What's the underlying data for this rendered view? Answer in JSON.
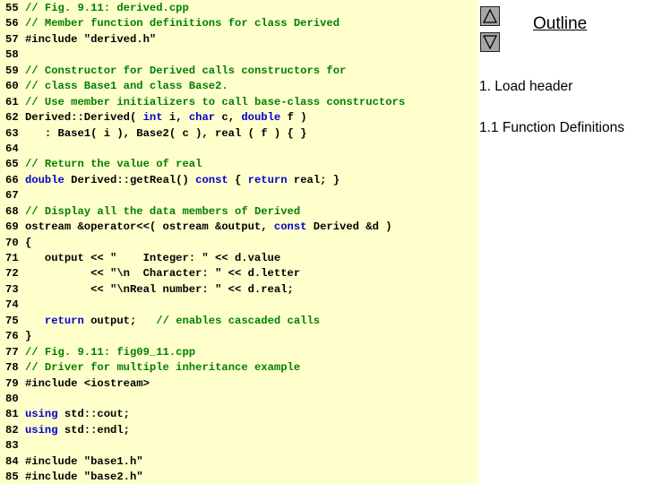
{
  "code": {
    "lines": [
      {
        "n": "55",
        "segments": [
          {
            "t": " ",
            "c": "plain"
          },
          {
            "t": "// Fig. 9.11: derived.cpp",
            "c": "comment"
          }
        ]
      },
      {
        "n": "56",
        "segments": [
          {
            "t": " ",
            "c": "plain"
          },
          {
            "t": "// Member function definitions for class Derived",
            "c": "comment"
          }
        ]
      },
      {
        "n": "57",
        "segments": [
          {
            "t": " #include \"derived.h\"",
            "c": "plain"
          }
        ]
      },
      {
        "n": "58",
        "segments": []
      },
      {
        "n": "59",
        "segments": [
          {
            "t": " ",
            "c": "plain"
          },
          {
            "t": "// Constructor for Derived calls constructors for",
            "c": "comment"
          }
        ]
      },
      {
        "n": "60",
        "segments": [
          {
            "t": " ",
            "c": "plain"
          },
          {
            "t": "// class Base1 and class Base2.",
            "c": "comment"
          }
        ]
      },
      {
        "n": "61",
        "segments": [
          {
            "t": " ",
            "c": "plain"
          },
          {
            "t": "// Use member initializers to call base-class constructors",
            "c": "comment"
          }
        ]
      },
      {
        "n": "62",
        "segments": [
          {
            "t": " Derived::Derived( ",
            "c": "plain"
          },
          {
            "t": "int",
            "c": "kw"
          },
          {
            "t": " i, ",
            "c": "plain"
          },
          {
            "t": "char",
            "c": "kw"
          },
          {
            "t": " c, ",
            "c": "plain"
          },
          {
            "t": "double",
            "c": "kw"
          },
          {
            "t": " f )",
            "c": "plain"
          }
        ]
      },
      {
        "n": "63",
        "segments": [
          {
            "t": "    : Base1( i ), Base2( c ), real ( f ) { }",
            "c": "plain"
          }
        ]
      },
      {
        "n": "64",
        "segments": []
      },
      {
        "n": "65",
        "segments": [
          {
            "t": " ",
            "c": "plain"
          },
          {
            "t": "// Return the value of real",
            "c": "comment"
          }
        ]
      },
      {
        "n": "66",
        "segments": [
          {
            "t": " ",
            "c": "plain"
          },
          {
            "t": "double",
            "c": "kw"
          },
          {
            "t": " Derived::getReal() ",
            "c": "plain"
          },
          {
            "t": "const",
            "c": "kw"
          },
          {
            "t": " { ",
            "c": "plain"
          },
          {
            "t": "return",
            "c": "kw"
          },
          {
            "t": " real; }",
            "c": "plain"
          }
        ]
      },
      {
        "n": "67",
        "segments": []
      },
      {
        "n": "68",
        "segments": [
          {
            "t": " ",
            "c": "plain"
          },
          {
            "t": "// Display all the data members of Derived",
            "c": "comment"
          }
        ]
      },
      {
        "n": "69",
        "segments": [
          {
            "t": " ostream &operator<<( ostream &output, ",
            "c": "plain"
          },
          {
            "t": "const",
            "c": "kw"
          },
          {
            "t": " Derived &d )",
            "c": "plain"
          }
        ]
      },
      {
        "n": "70",
        "segments": [
          {
            "t": " {",
            "c": "plain"
          }
        ]
      },
      {
        "n": "71",
        "segments": [
          {
            "t": "    output << \"    Integer: \" << d.value",
            "c": "plain"
          }
        ]
      },
      {
        "n": "72",
        "segments": [
          {
            "t": "           << \"\\n  Character: \" << d.letter",
            "c": "plain"
          }
        ]
      },
      {
        "n": "73",
        "segments": [
          {
            "t": "           << \"\\nReal number: \" << d.real;",
            "c": "plain"
          }
        ]
      },
      {
        "n": "74",
        "segments": []
      },
      {
        "n": "75",
        "segments": [
          {
            "t": "    ",
            "c": "plain"
          },
          {
            "t": "return",
            "c": "kw"
          },
          {
            "t": " output;   ",
            "c": "plain"
          },
          {
            "t": "// enables cascaded calls",
            "c": "comment"
          }
        ]
      },
      {
        "n": "76",
        "segments": [
          {
            "t": " }",
            "c": "plain"
          }
        ]
      },
      {
        "n": "77",
        "segments": [
          {
            "t": " ",
            "c": "plain"
          },
          {
            "t": "// Fig. 9.11: fig09_11.cpp",
            "c": "comment"
          }
        ]
      },
      {
        "n": "78",
        "segments": [
          {
            "t": " ",
            "c": "plain"
          },
          {
            "t": "// Driver for multiple inheritance example",
            "c": "comment"
          }
        ]
      },
      {
        "n": "79",
        "segments": [
          {
            "t": " #include <iostream>",
            "c": "plain"
          }
        ]
      },
      {
        "n": "80",
        "segments": []
      },
      {
        "n": "81",
        "segments": [
          {
            "t": " ",
            "c": "plain"
          },
          {
            "t": "using",
            "c": "kw"
          },
          {
            "t": " std::cout;",
            "c": "plain"
          }
        ]
      },
      {
        "n": "82",
        "segments": [
          {
            "t": " ",
            "c": "plain"
          },
          {
            "t": "using",
            "c": "kw"
          },
          {
            "t": " std::endl;",
            "c": "plain"
          }
        ]
      },
      {
        "n": "83",
        "segments": []
      },
      {
        "n": "84",
        "segments": [
          {
            "t": " #include \"base1.h\"",
            "c": "plain"
          }
        ]
      },
      {
        "n": "85",
        "segments": [
          {
            "t": " #include \"base2.h\"",
            "c": "plain"
          }
        ]
      }
    ]
  },
  "sidebar": {
    "title": "Outline",
    "items": [
      "1. Load header",
      "1.1 Function Definitions"
    ],
    "up_icon": "triangle-up-icon",
    "down_icon": "triangle-down-icon"
  },
  "colors": {
    "code_background": "#ffffcc",
    "comment": "#008000",
    "keyword": "#0000cc",
    "button": "#a6a6a6"
  }
}
